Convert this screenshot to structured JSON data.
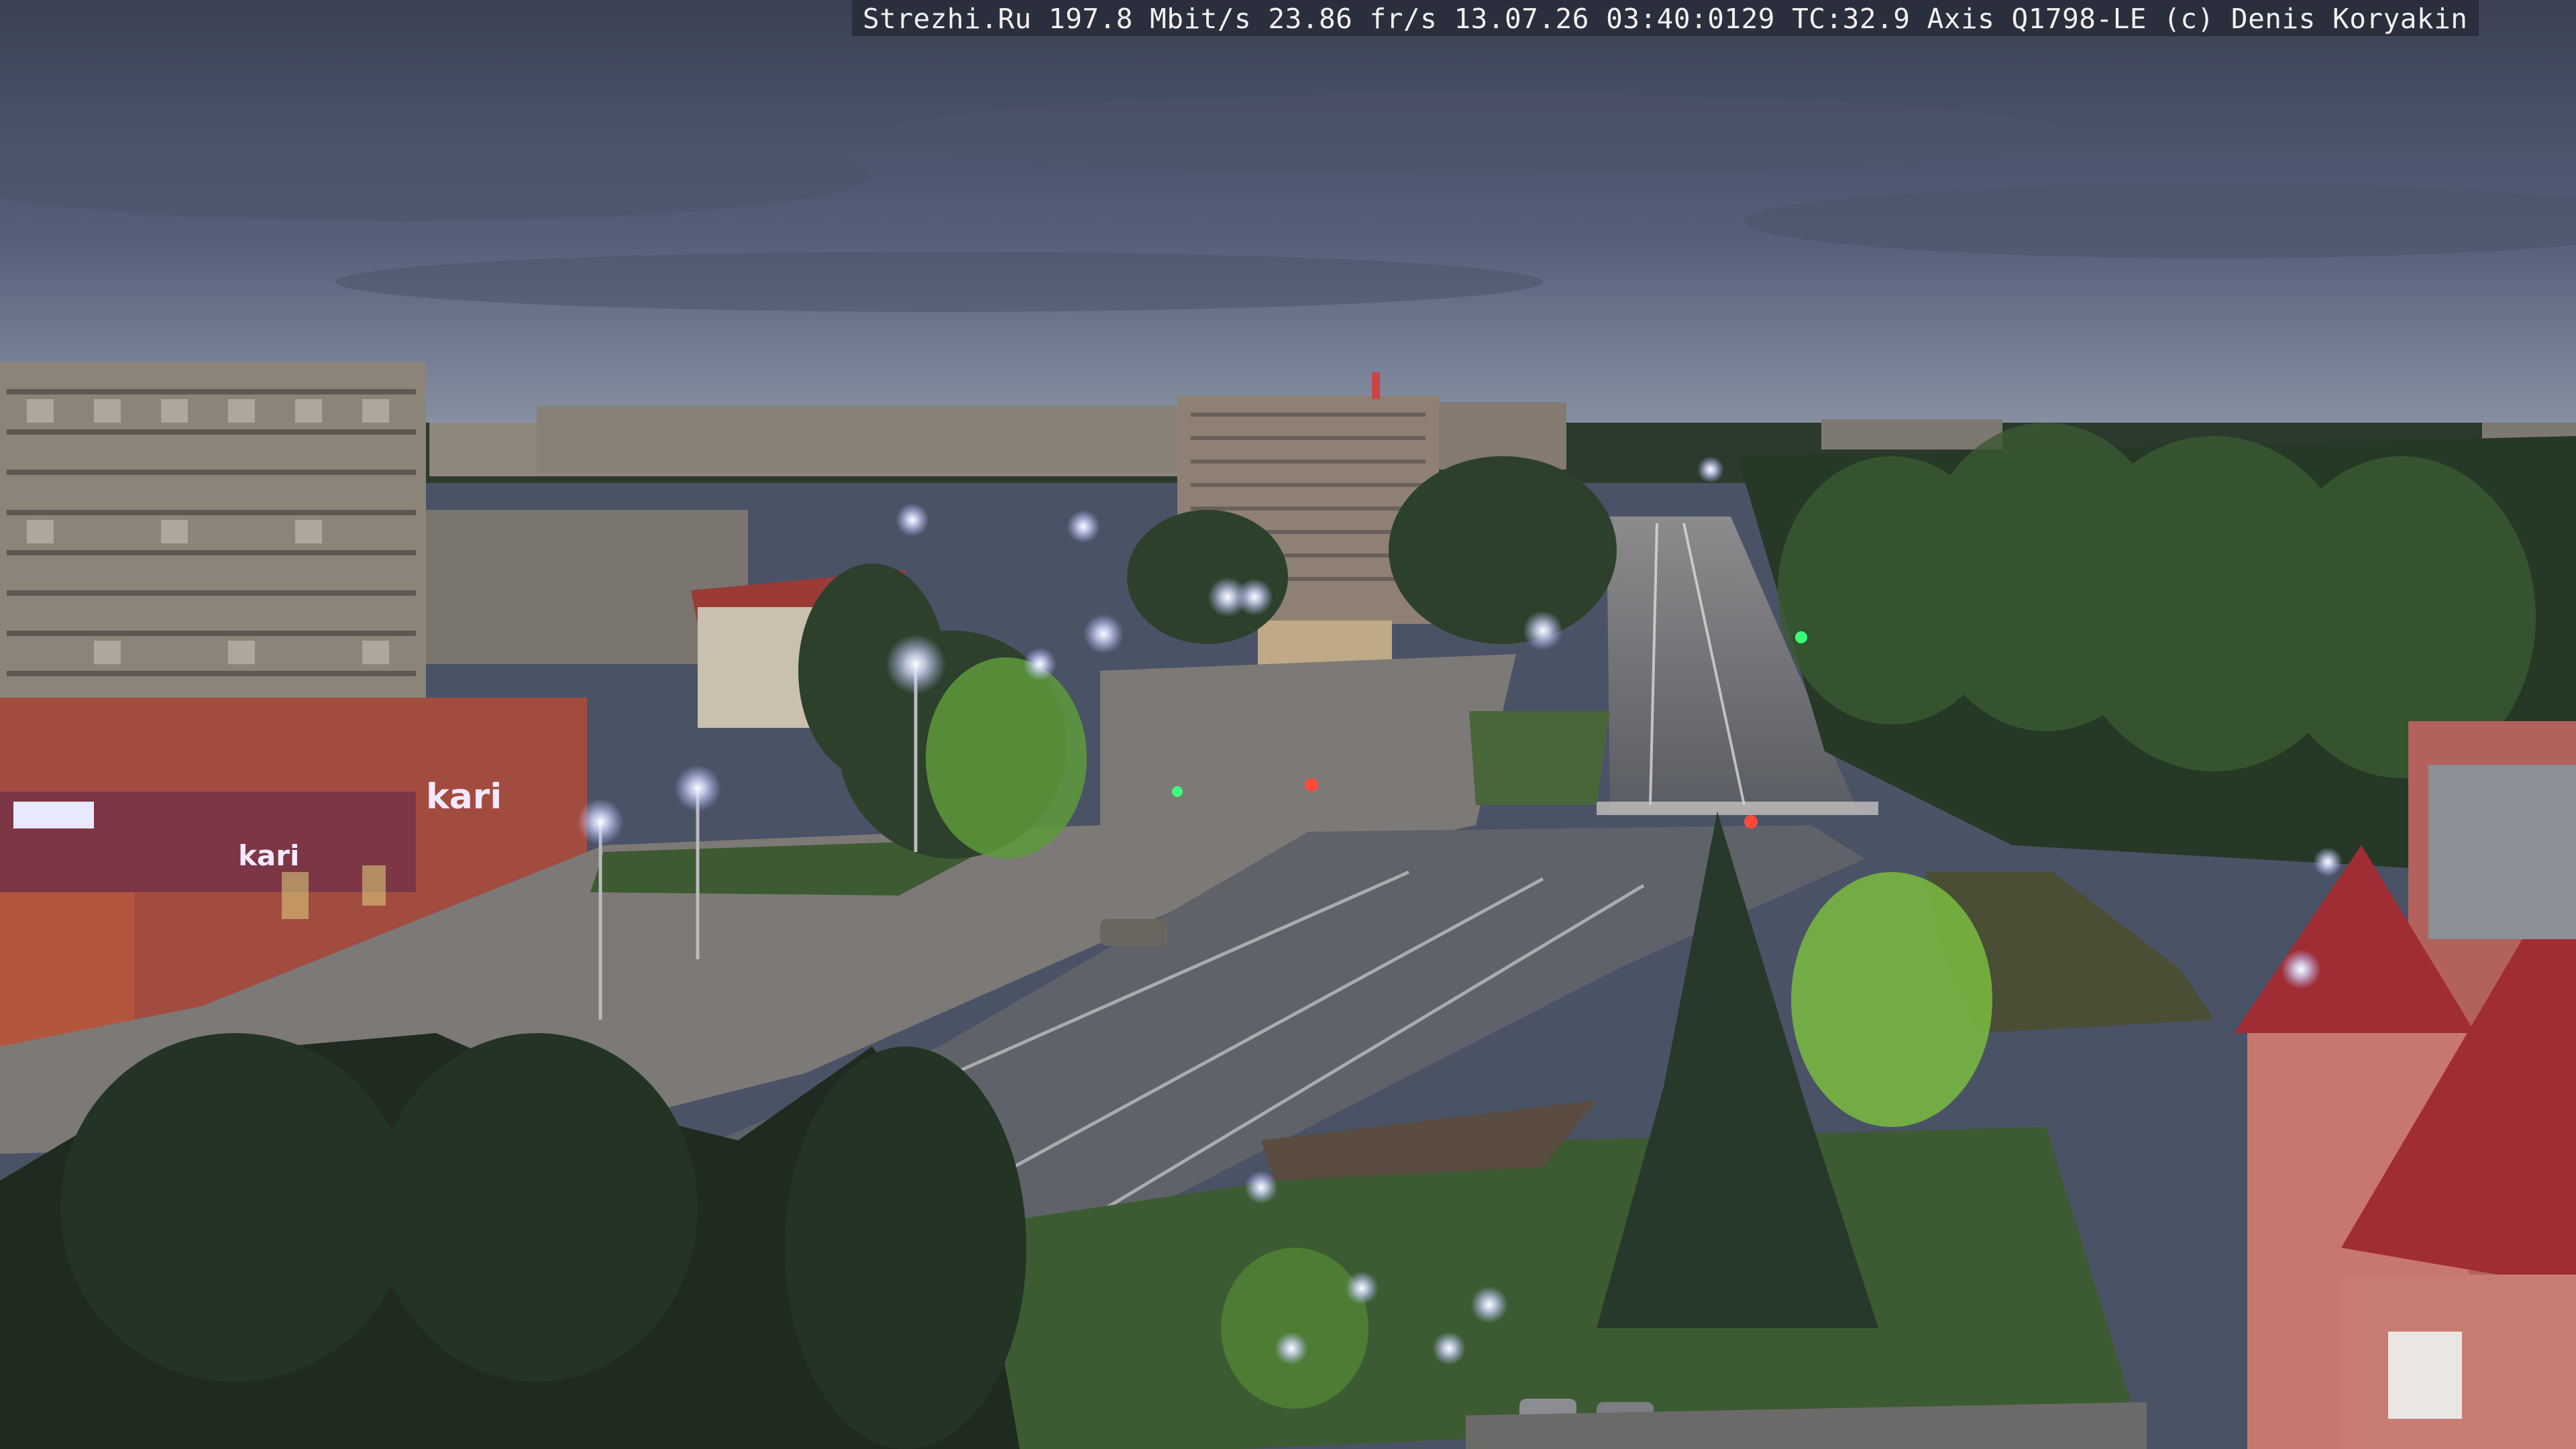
{
  "overlay": {
    "text": "Strezhi.Ru 197.8 Mbit/s 23.86 fr/s 13.07.26 03:40:0129 TC:32.9  Axis Q1798-LE  (c) Denis Koryakin"
  },
  "signs": {
    "store_sign": "kari",
    "store_sign_small": "kari"
  },
  "colors": {
    "sky_top": "#3f4658",
    "sky_horizon": "#8a93a3",
    "asphalt": "#5d6066",
    "plaza": "#7d7a77",
    "grass": "#3f5a34",
    "trees_dark": "#1f2a1f",
    "tree_lit": "#7fbf45",
    "lamp": "#d9dcff",
    "brick": "#a64d3e",
    "roof_red": "#a32f35",
    "panel_building": "#8a8378"
  }
}
